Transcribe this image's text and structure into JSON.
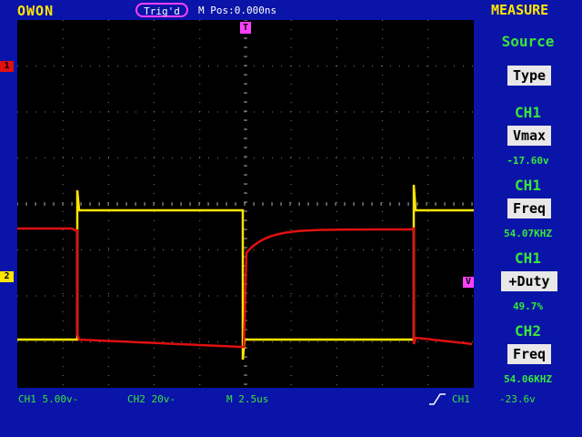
{
  "header": {
    "brand": "OWON",
    "trigger_status": "Trig'd",
    "m_pos": "M Pos:0.000ns",
    "measure_title": "MEASURE"
  },
  "measure_panel": {
    "source": {
      "title": "Source",
      "type_label": "Type"
    },
    "items": [
      {
        "channel": "CH1",
        "type": "Vmax",
        "value": "-17.60v"
      },
      {
        "channel": "CH1",
        "type": "Freq",
        "value": "54.07KHZ"
      },
      {
        "channel": "CH1",
        "type": "+Duty",
        "value": "49.7%"
      },
      {
        "channel": "CH2",
        "type": "Freq",
        "value": "54.06KHZ"
      }
    ]
  },
  "status_bar": {
    "ch1_scale": "CH1  5.00v-",
    "ch2_scale": "CH2  20v-",
    "timebase": "M 2.5us",
    "trigger_source": "CH1",
    "trigger_level": "-23.6v"
  },
  "markers": {
    "ch1": "1",
    "ch2": "2",
    "trigger_pos": "T",
    "trigger_level_marker": "V"
  },
  "colors": {
    "background": "#0a14a8",
    "screen": "#000000",
    "ch1_trace": "#e01010",
    "ch2_trace": "#ffe600",
    "panel_text": "#36e63a",
    "brand": "#ffe600",
    "marker": "#ff40ff"
  },
  "icons": {
    "trigger_edge": "rising-edge-icon"
  }
}
